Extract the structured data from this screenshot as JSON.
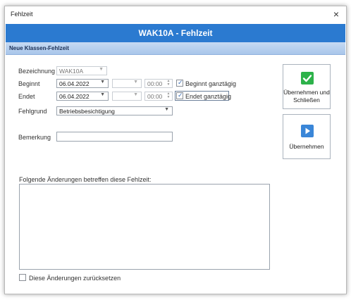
{
  "window": {
    "title": "Fehlzeit",
    "close_glyph": "×"
  },
  "header": {
    "title": "WAK10A - Fehlzeit",
    "color": "#2b7ad0"
  },
  "section": {
    "title": "Neue Klassen-Fehlzeit"
  },
  "form": {
    "bezeichnung": {
      "label": "Bezeichnung",
      "value": "WAK10A"
    },
    "beginnt": {
      "label": "Beginnt",
      "date": "06.04.2022",
      "time": "00:00",
      "allday_label": "Beginnt ganztägig",
      "allday_checked": true
    },
    "endet": {
      "label": "Endet",
      "date": "06.04.2022",
      "time": "00:00",
      "allday_label": "Endet ganztägig",
      "allday_checked": true
    },
    "fehlgrund": {
      "label": "Fehlgrund",
      "value": "Betriebsbesichtigung"
    },
    "bemerkung": {
      "label": "Bemerkung",
      "value": ""
    }
  },
  "changes": {
    "label": "Folgende Änderungen betreffen diese Fehlzeit:",
    "reset_label": "Diese Änderungen zurücksetzen",
    "reset_checked": false
  },
  "buttons": {
    "apply_close": {
      "label": "Übernehmen und Schließen",
      "icon": "checkmark-icon"
    },
    "apply": {
      "label": "Übernehmen",
      "icon": "play-arrow-icon"
    }
  }
}
